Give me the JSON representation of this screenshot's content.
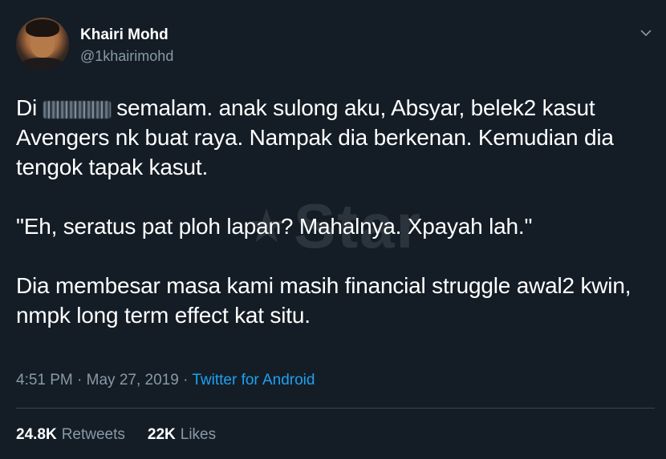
{
  "user": {
    "display_name": "Khairi Mohd",
    "handle": "@1khairimohd"
  },
  "tweet": {
    "line1_prefix": "Di",
    "line1_suffix": "semalam. anak sulong aku, Absyar, belek2 kasut Avengers nk buat raya. Nampak dia berkenan. Kemudian dia tengok tapak kasut.",
    "paragraph2": "\"Eh, seratus pat ploh lapan? Mahalnya. Xpayah lah.\"",
    "paragraph3": "Dia membesar masa kami masih financial struggle awal2 kwin, nmpk long term effect kat situ."
  },
  "watermark": {
    "text": "Star"
  },
  "meta": {
    "time": "4:51 PM",
    "separator1": " · ",
    "date": "May 27, 2019",
    "separator2": " · ",
    "source": "Twitter for Android"
  },
  "stats": {
    "retweets_count": "24.8K",
    "retweets_label": "Retweets",
    "likes_count": "22K",
    "likes_label": "Likes"
  },
  "colors": {
    "background": "#141d26",
    "text": "#ffffff",
    "muted": "#8899a6",
    "link": "#1da1f2",
    "divider": "#38444d"
  },
  "icons": {
    "menu": "chevron-down-icon"
  }
}
